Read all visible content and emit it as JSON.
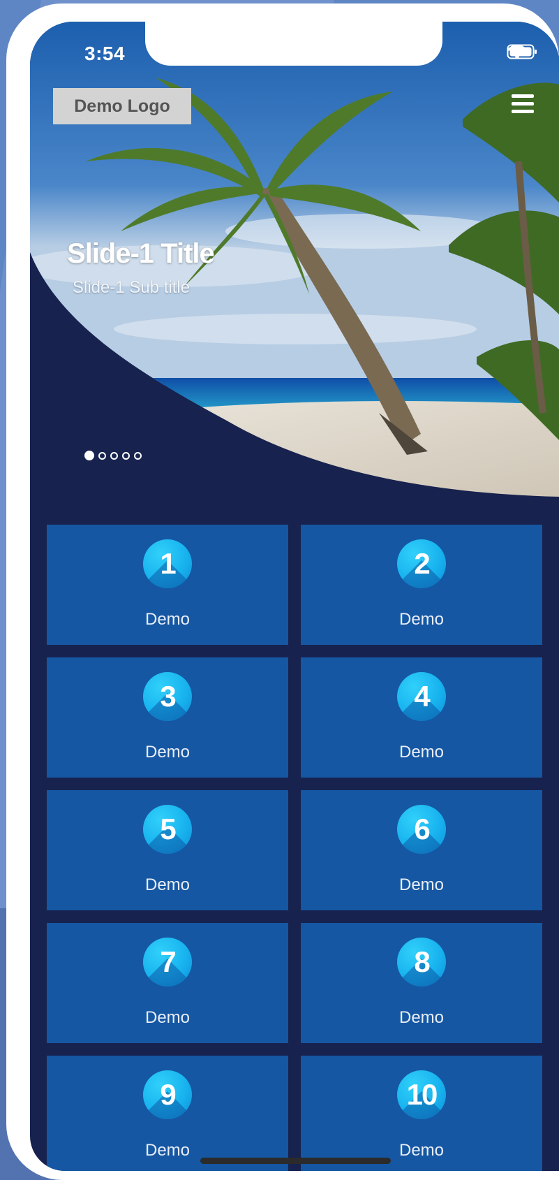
{
  "status_bar": {
    "time": "3:54",
    "icons": [
      "signal-icon",
      "wifi-icon",
      "battery-icon"
    ]
  },
  "header": {
    "logo_text": "Demo Logo",
    "menu_icon": "hamburger-menu-icon"
  },
  "hero": {
    "title": "Slide-1 Title",
    "subtitle": "Slide-1 Sub title",
    "slide_count": 5,
    "active_slide": 1
  },
  "tiles": [
    {
      "number": "1",
      "label": "Demo"
    },
    {
      "number": "2",
      "label": "Demo"
    },
    {
      "number": "3",
      "label": "Demo"
    },
    {
      "number": "4",
      "label": "Demo"
    },
    {
      "number": "5",
      "label": "Demo"
    },
    {
      "number": "6",
      "label": "Demo"
    },
    {
      "number": "7",
      "label": "Demo"
    },
    {
      "number": "8",
      "label": "Demo"
    },
    {
      "number": "9",
      "label": "Demo"
    },
    {
      "number": "10",
      "label": "Demo"
    }
  ],
  "colors": {
    "background": "#5f86c4",
    "screen_bg": "#17224e",
    "tile_bg": "#1557a3",
    "icon_accent": "#18b3ef"
  }
}
